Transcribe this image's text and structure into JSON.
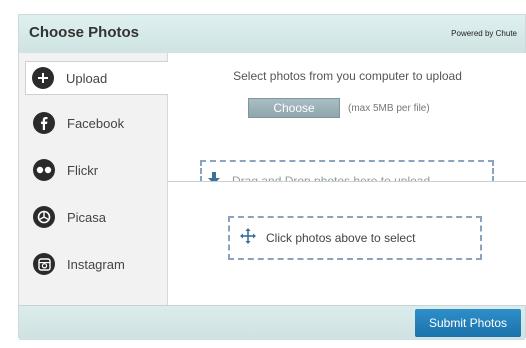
{
  "header": {
    "title": "Choose Photos",
    "powered_by": "Powered by Chute"
  },
  "sidebar": {
    "items": [
      {
        "label": "Upload",
        "icon": "upload-plus-icon",
        "active": true
      },
      {
        "label": "Facebook",
        "icon": "facebook-icon",
        "active": false
      },
      {
        "label": "Flickr",
        "icon": "flickr-icon",
        "active": false
      },
      {
        "label": "Picasa",
        "icon": "picasa-icon",
        "active": false
      },
      {
        "label": "Instagram",
        "icon": "instagram-icon",
        "active": false
      }
    ]
  },
  "upload": {
    "hint": "Select photos from you computer to upload",
    "choose_label": "Choose",
    "max_size": "(max 5MB per file)",
    "drop_text": "Drag and Drop photos here to upload"
  },
  "selection": {
    "text": "Click photos above to select"
  },
  "footer": {
    "submit_label": "Submit Photos"
  },
  "colors": {
    "accent": "#1b73aa",
    "header_bg": "#d7eaea",
    "dash": "#8aa4bf"
  }
}
